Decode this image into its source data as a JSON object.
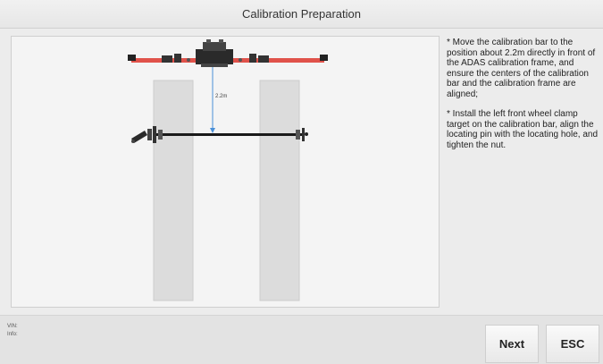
{
  "window": {
    "title": "Calibration Preparation"
  },
  "diagram": {
    "distance_label": "2.2m"
  },
  "instructions": {
    "step1": "* Move the calibration bar to the position about 2.2m directly in front of the ADAS calibration frame, and ensure the centers of the calibration bar and the calibration frame are aligned;",
    "step2": "* Install the left front wheel clamp target on the calibration bar, align the locating pin with the locating hole, and tighten the nut."
  },
  "footer": {
    "vin_label": "VIN:",
    "info_label": "Info:"
  },
  "buttons": {
    "next": "Next",
    "esc": "ESC"
  },
  "colors": {
    "frame_bar": "#e0524a",
    "distance_line": "#4a90d9",
    "calibration_bar": "#1a1a1a",
    "wheel_lane": "#dcdcdc"
  }
}
